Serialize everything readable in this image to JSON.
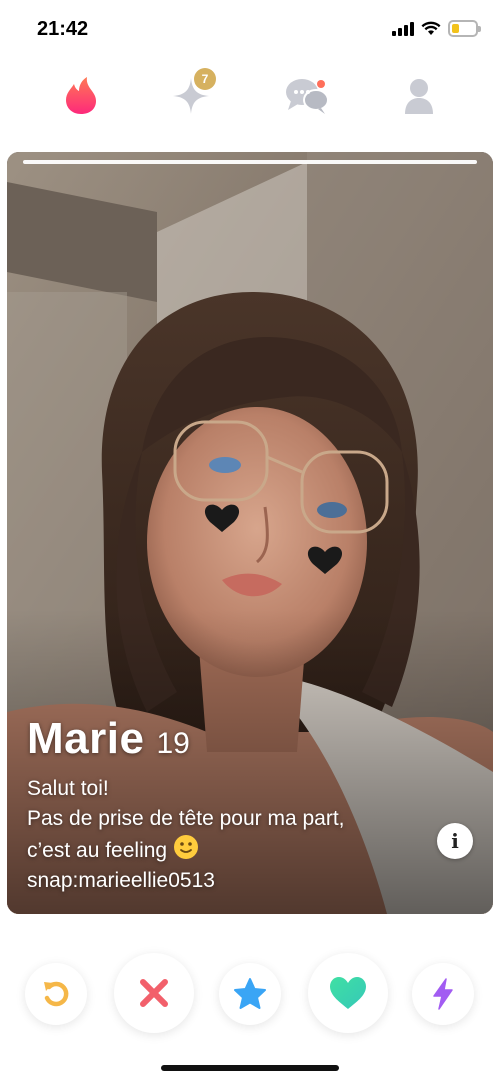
{
  "status_bar": {
    "time": "21:42",
    "icons": [
      "signal-icon",
      "wifi-icon",
      "battery-icon"
    ],
    "battery_color": "#f2c21b"
  },
  "top_nav": {
    "items": [
      {
        "name": "discover",
        "icon": "flame-icon",
        "active": true,
        "color": "#ff5a5f"
      },
      {
        "name": "top-picks",
        "icon": "sparkle-icon",
        "badge": "7",
        "color": "#c7c9d1"
      },
      {
        "name": "messages",
        "icon": "chat-icon",
        "has_dot": true,
        "color": "#c7c9d1"
      },
      {
        "name": "profile",
        "icon": "person-icon",
        "color": "#c7c9d1"
      }
    ]
  },
  "card": {
    "name": "Marie",
    "age": "19",
    "bio_lines": [
      "Salut toi!",
      "Pas de prise de tête pour ma part,",
      "c’est au feeling",
      "snap:marieellie0513"
    ],
    "photo_count": 1,
    "active_photo": 1
  },
  "actions": [
    {
      "name": "rewind",
      "icon": "rewind-icon",
      "color": "#f5b748"
    },
    {
      "name": "nope",
      "icon": "x-icon",
      "color": "#f2606b"
    },
    {
      "name": "super-like",
      "icon": "star-icon",
      "color": "#3aa5f5"
    },
    {
      "name": "like",
      "icon": "heart-icon",
      "color": "#3fd8a9"
    },
    {
      "name": "boost",
      "icon": "bolt-icon",
      "color": "#a25cf2"
    }
  ]
}
